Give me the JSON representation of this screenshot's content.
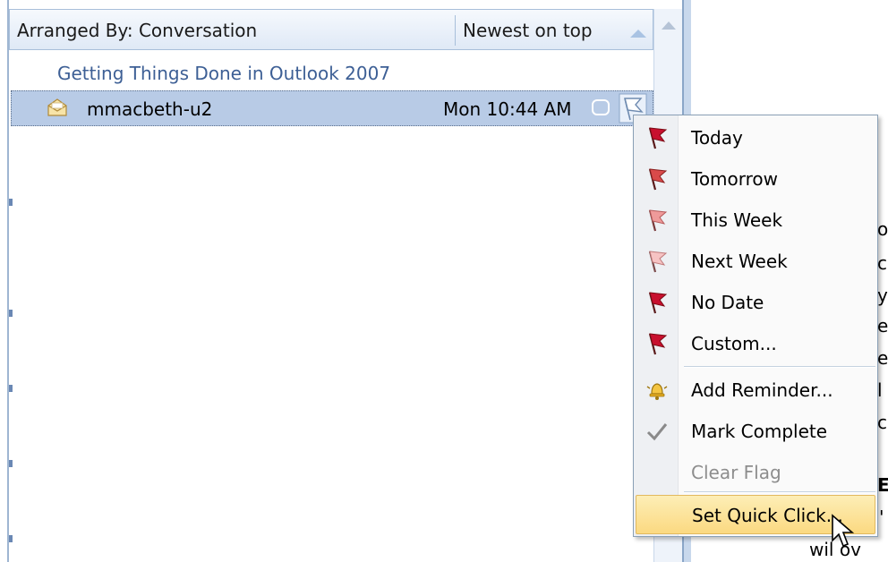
{
  "header": {
    "arranged_by": "Arranged By: Conversation",
    "sort_order": "Newest on top"
  },
  "group": {
    "title": "Getting Things Done in Outlook 2007"
  },
  "message": {
    "sender": "mmacbeth-u2",
    "date": "Mon 10:44 AM",
    "icon": "open-envelope-icon",
    "flag_icon": "flag-outline-icon"
  },
  "context_menu": {
    "items": [
      {
        "label": "Today",
        "icon": "flag-red-icon",
        "color": "#c8102e"
      },
      {
        "label": "Tomorrow",
        "icon": "flag-red-icon",
        "color": "#d94a4a"
      },
      {
        "label": "This Week",
        "icon": "flag-pink-icon",
        "color": "#ef9a9a"
      },
      {
        "label": "Next Week",
        "icon": "flag-pink-icon",
        "color": "#f3b0b0"
      },
      {
        "label": "No Date",
        "icon": "flag-red-icon",
        "color": "#c8102e"
      },
      {
        "label": "Custom...",
        "icon": "flag-red-icon",
        "color": "#c8102e"
      },
      {
        "label": "Add Reminder...",
        "icon": "bell-icon"
      },
      {
        "label": "Mark Complete",
        "icon": "checkmark-icon"
      },
      {
        "label": "Clear Flag",
        "disabled": true
      },
      {
        "label": "Set Quick Click...",
        "highlighted": true
      }
    ]
  },
  "reading_pane": {
    "fragments": [
      "o",
      "c",
      "y",
      "e",
      "e",
      "l",
      "c",
      "E",
      "'",
      "wil ov"
    ]
  },
  "colors": {
    "selected_row": "#b8cbe6",
    "group_title": "#3d5f95",
    "menu_hover": "#fbd981"
  }
}
